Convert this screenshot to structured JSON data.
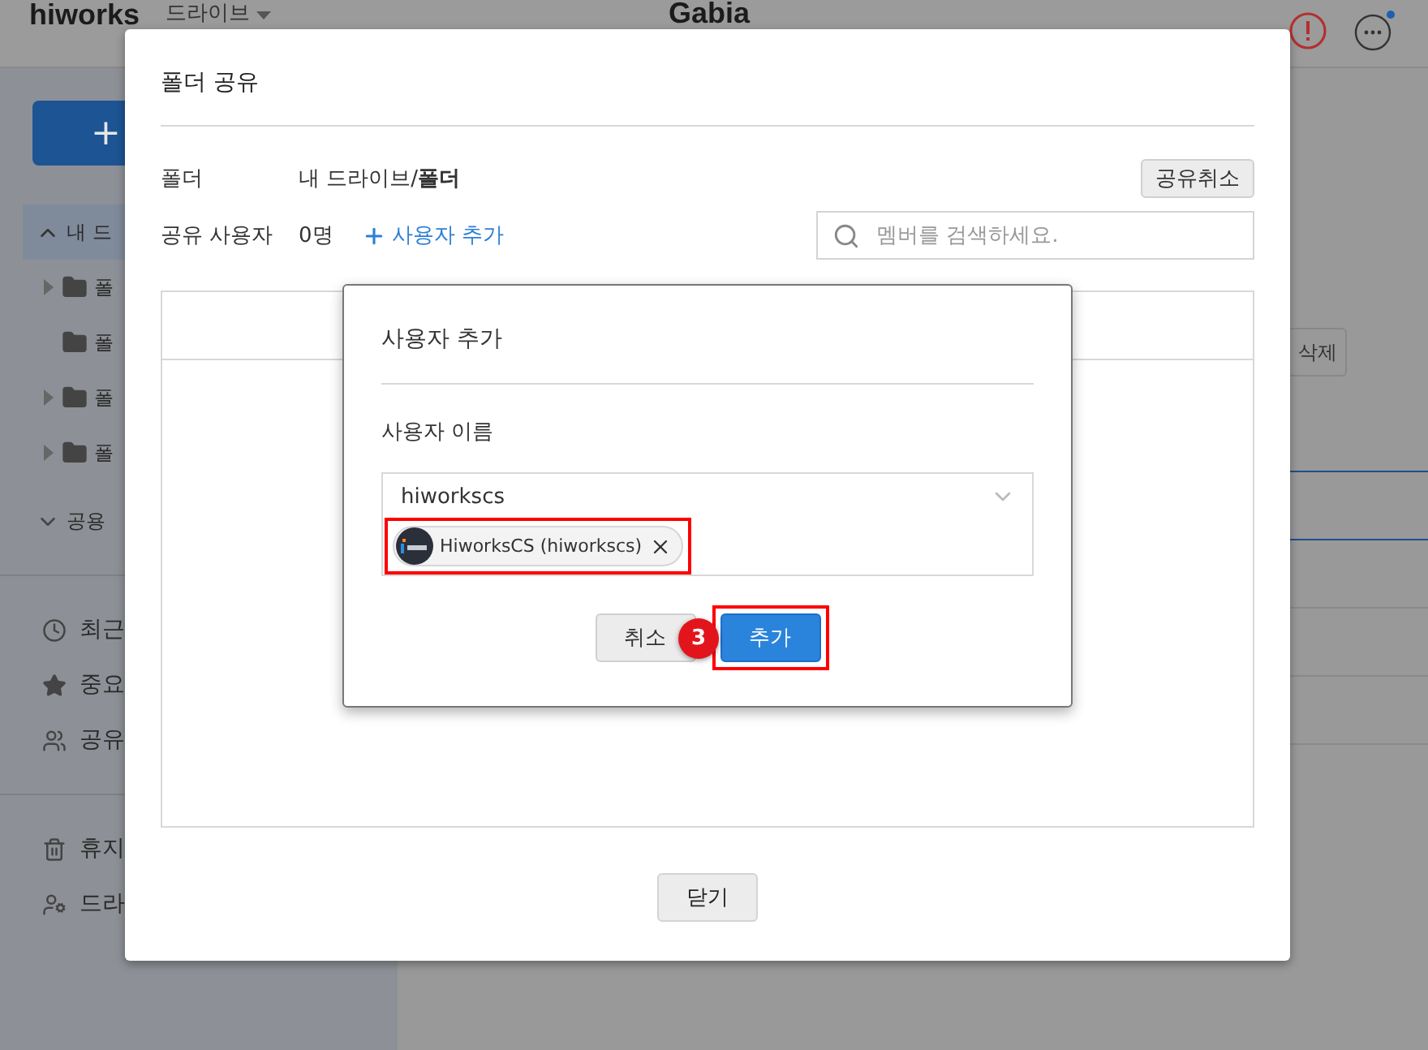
{
  "header": {
    "logo": "hiworks",
    "app_menu": "드라이브",
    "title": "Gabia"
  },
  "sidebar": {
    "new_button": "+",
    "tree": [
      {
        "label": "내 드",
        "expanded": true,
        "selected": true,
        "children": [
          {
            "label": "폴",
            "has_children": true
          },
          {
            "label": "폴",
            "has_children": false
          },
          {
            "label": "폴",
            "has_children": true
          },
          {
            "label": "폴",
            "has_children": true
          }
        ]
      },
      {
        "label": "공용",
        "expanded": false,
        "selected": false
      }
    ],
    "nav": [
      {
        "label": "최근",
        "kind": "clock"
      },
      {
        "label": "중요",
        "kind": "star"
      },
      {
        "label": "공유",
        "kind": "people"
      }
    ],
    "tools": [
      {
        "label": "휴지",
        "kind": "trash"
      },
      {
        "label": "드라",
        "kind": "user-settings"
      }
    ]
  },
  "main": {
    "delete_button": "삭제"
  },
  "share_dialog": {
    "title": "폴더 공유",
    "folder_label": "폴더",
    "folder_path": "내 드라이브/**폴더**",
    "cancel_share_button": "공유취소",
    "users_label": "공유 사용자",
    "user_count": "0명",
    "add_user_link": "사용자 추가",
    "search": {
      "placeholder": "멤버를 검색하세요."
    },
    "close_button": "닫기"
  },
  "add_user_dialog": {
    "title": "사용자 추가",
    "name_label": "사용자 이름",
    "input": {
      "value": "hiworkscs"
    },
    "chips": [
      {
        "label": "HiworksCS (hiworkscs)",
        "highlighted": true
      }
    ],
    "buttons": [
      {
        "label": "취소",
        "kind": "secondary",
        "highlighted": false
      },
      {
        "label": "추가",
        "kind": "primary",
        "highlighted": true
      }
    ],
    "step_badge": "3"
  }
}
